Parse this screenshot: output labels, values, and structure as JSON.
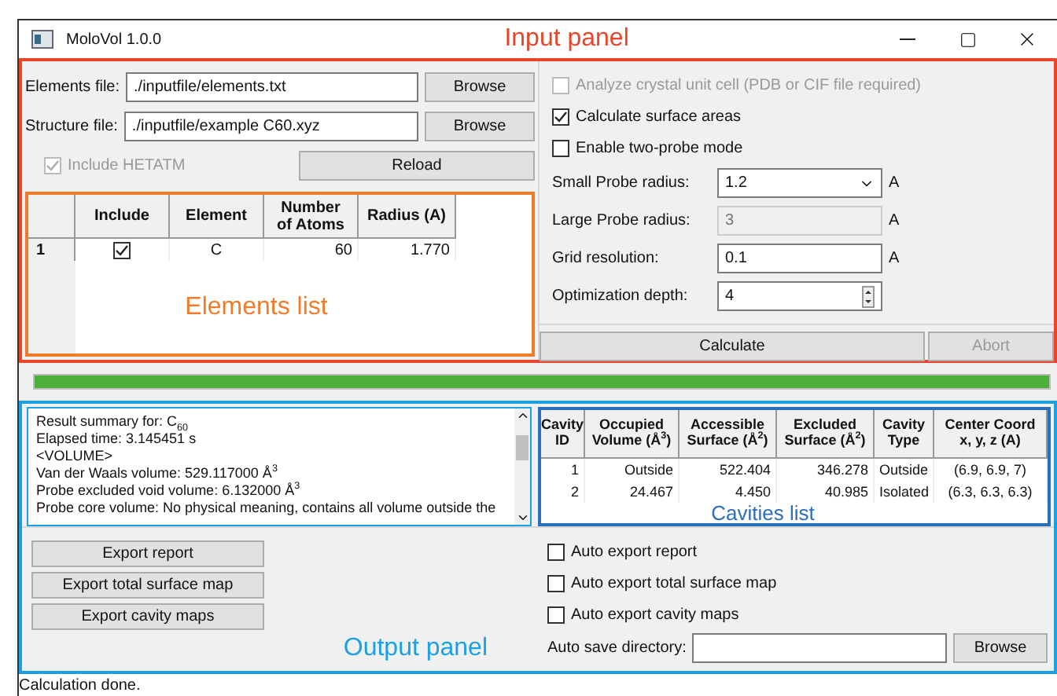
{
  "window": {
    "title": "MoloVol 1.0.0"
  },
  "input_panel": {
    "annotation": "Input panel",
    "files": [
      {
        "label": "Elements file:",
        "value": "./inputfile/elements.txt",
        "button": "Browse"
      },
      {
        "label": "Structure file:",
        "value": "./inputfile/example C60.xyz",
        "button": "Browse"
      }
    ],
    "include_hetatm": {
      "label": "Include HETATM",
      "checked": true,
      "disabled": true
    },
    "reload_button": "Reload",
    "elements_table": {
      "annotation": "Elements list",
      "columns": [
        "Include",
        "Element",
        "Number\nof Atoms",
        "Radius (A)"
      ],
      "rows": [
        {
          "index": "1",
          "include": true,
          "element": "C",
          "atoms": "60",
          "radius": "1.770"
        }
      ]
    },
    "options": [
      {
        "label": "Analyze crystal unit cell (PDB or CIF file required)",
        "checked": false,
        "disabled": true
      },
      {
        "label": "Calculate surface areas",
        "checked": true,
        "disabled": false
      },
      {
        "label": "Enable two-probe mode",
        "checked": false,
        "disabled": false
      }
    ],
    "parameters": [
      {
        "kind": "dropdown",
        "label": "Small Probe radius:",
        "value": "1.2",
        "unit": "A",
        "disabled": false
      },
      {
        "kind": "text",
        "label": "Large Probe radius:",
        "value": "3",
        "unit": "A",
        "disabled": true
      },
      {
        "kind": "text",
        "label": "Grid resolution:",
        "value": "0.1",
        "unit": "A",
        "disabled": false
      },
      {
        "kind": "spinner",
        "label": "Optimization depth:",
        "value": "4",
        "disabled": false
      }
    ],
    "buttons": [
      {
        "label": "Calculate",
        "disabled": false
      },
      {
        "label": "Abort",
        "disabled": true
      }
    ]
  },
  "progress": {
    "level": 1
  },
  "output_panel": {
    "annotation": "Output panel",
    "summary_lines": [
      "Result summary for: C$_{60}$",
      "Elapsed time: 3.145451 s",
      "<VOLUME>",
      "Van der Waals volume: 529.117000 Å$^{3}$",
      "Probe excluded void volume: 6.132000 Å$^{3}$",
      "Probe core volume: No physical meaning, contains all volume outside the"
    ],
    "cavities_table": {
      "annotation": "Cavities list",
      "columns": [
        "Cavity\nID",
        "Occupied\nVolume (Å$^{3}$)",
        "Accessible\nSurface (Å$^{2}$)",
        "Excluded\nSurface (Å$^{2}$)",
        "Cavity\nType",
        "Center Coord\nx, y, z (A)"
      ],
      "rows": [
        [
          "1",
          "Outside",
          "522.404",
          "346.278",
          "Outside",
          "(6.9, 6.9, 7)"
        ],
        [
          "2",
          "24.467",
          "4.450",
          "40.985",
          "Isolated",
          "(6.3, 6.3, 6.3)"
        ]
      ]
    },
    "export_buttons": [
      "Export report",
      "Export total surface map",
      "Export cavity maps"
    ],
    "auto_export": [
      {
        "label": "Auto export report",
        "checked": false
      },
      {
        "label": "Auto export total surface map",
        "checked": false
      },
      {
        "label": "Auto export cavity maps",
        "checked": false
      }
    ],
    "auto_save": {
      "label": "Auto save directory:",
      "button": "Browse"
    }
  },
  "status_bar": "Calculation done."
}
